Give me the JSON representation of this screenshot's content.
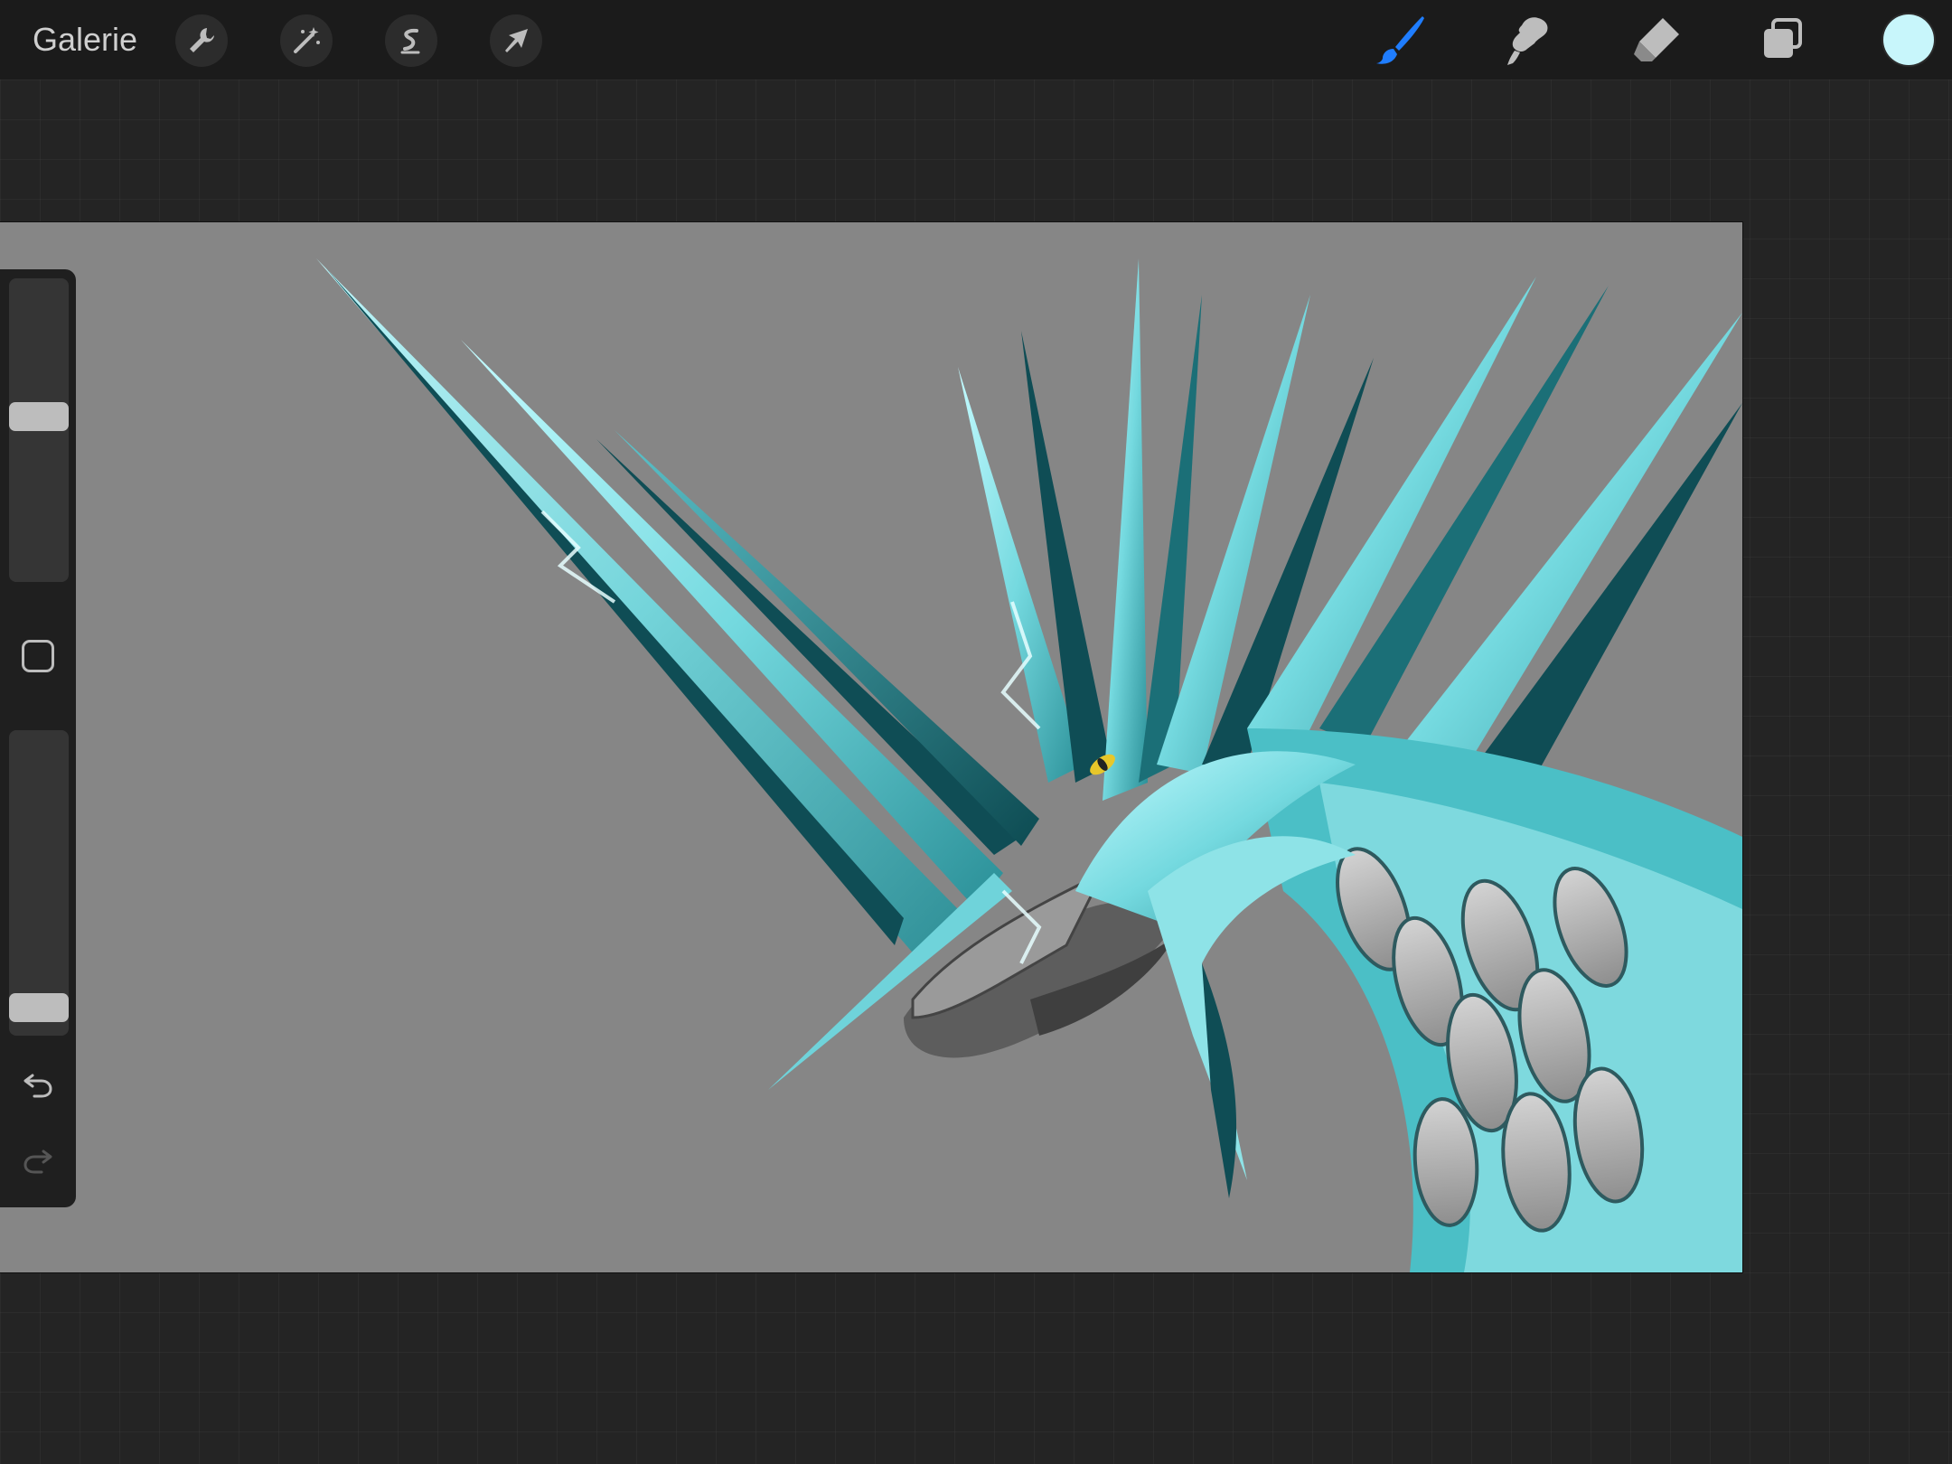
{
  "toolbar": {
    "gallery_label": "Galerie",
    "left_tools": [
      "wrench-icon",
      "magic-wand-icon",
      "selection-icon",
      "transform-arrow-icon"
    ],
    "right_tools": [
      "brush-icon",
      "smudge-icon",
      "eraser-icon",
      "layers-icon"
    ],
    "active_tool": "brush-icon",
    "current_color": "#c8f6fb"
  },
  "sidebar": {
    "brush_size": 0.55,
    "opacity": 0.05,
    "buttons": [
      "modify-square-icon",
      "undo-icon",
      "redo-icon"
    ]
  },
  "canvas": {
    "background_color": "#868686",
    "artwork": "ice-dragon-illustration"
  }
}
